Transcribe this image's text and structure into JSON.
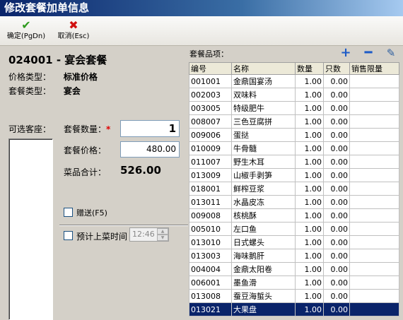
{
  "window": {
    "title": "修改套餐加单信息"
  },
  "toolbar": {
    "confirm_label": "确定(PgDn)",
    "cancel_label": "取消(Esc)"
  },
  "package": {
    "title": "024001 - 宴会套餐",
    "price_type_label": "价格类型：",
    "price_type_value": "标准价格",
    "package_type_label": "套餐类型：",
    "package_type_value": "宴会"
  },
  "seats": {
    "label": "可选客座："
  },
  "form": {
    "quantity_label": "套餐数量：",
    "required_mark": "*",
    "quantity_value": "1",
    "price_label": "套餐价格：",
    "price_value": "480.00",
    "total_label": "菜品合计：",
    "total_value": "526.00",
    "gift_label": "赠送(F5)",
    "eta_label": "预计上菜时间",
    "eta_value": "12:46"
  },
  "grid": {
    "title": "套餐品项：",
    "columns": [
      "编号",
      "名称",
      "数量",
      "只数",
      "销售限量"
    ],
    "rows": [
      [
        "001001",
        "金鼎国宴汤",
        "1.00",
        "0.00",
        ""
      ],
      [
        "002003",
        "双味料",
        "1.00",
        "0.00",
        ""
      ],
      [
        "003005",
        "特级肥牛",
        "1.00",
        "0.00",
        ""
      ],
      [
        "008007",
        "三色豆腐拼",
        "1.00",
        "0.00",
        ""
      ],
      [
        "009006",
        "蛋挞",
        "1.00",
        "0.00",
        ""
      ],
      [
        "010009",
        "牛骨髓",
        "1.00",
        "0.00",
        ""
      ],
      [
        "011007",
        "野生木耳",
        "1.00",
        "0.00",
        ""
      ],
      [
        "013009",
        "山椒手剥笋",
        "1.00",
        "0.00",
        ""
      ],
      [
        "018001",
        "鲜榨豆浆",
        "1.00",
        "0.00",
        ""
      ],
      [
        "013011",
        "水晶皮冻",
        "1.00",
        "0.00",
        ""
      ],
      [
        "009008",
        "核桃酥",
        "1.00",
        "0.00",
        ""
      ],
      [
        "005010",
        "左口鱼",
        "1.00",
        "0.00",
        ""
      ],
      [
        "013010",
        "日式螺头",
        "1.00",
        "0.00",
        ""
      ],
      [
        "013003",
        "海味鹅肝",
        "1.00",
        "0.00",
        ""
      ],
      [
        "004004",
        "金鼎太阳卷",
        "1.00",
        "0.00",
        ""
      ],
      [
        "006001",
        "墨鱼滑",
        "1.00",
        "0.00",
        ""
      ],
      [
        "013008",
        "蚕豆海蜇头",
        "1.00",
        "0.00",
        ""
      ],
      [
        "013021",
        "大果盘",
        "1.00",
        "0.00",
        ""
      ]
    ],
    "selected_row": 17
  },
  "colors": {
    "accent": "#0a246a",
    "confirm": "#2e9a1e",
    "cancel": "#d01010",
    "required": "#e00000"
  }
}
